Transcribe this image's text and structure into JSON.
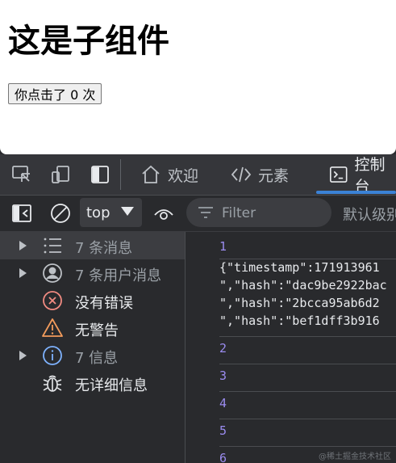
{
  "page": {
    "heading": "这是子组件",
    "button_label": "你点击了 0 次"
  },
  "devtools": {
    "tabs": [
      {
        "label": "欢迎",
        "icon": "home-icon"
      },
      {
        "label": "元素",
        "icon": "code-icon"
      },
      {
        "label": "控制台",
        "icon": "console-icon",
        "active": true
      }
    ],
    "toolbar": {
      "context": "top",
      "filter_placeholder": "Filter",
      "levels_label": "默认级别"
    },
    "sidebar": [
      {
        "label": "7 条消息",
        "icon": "list-icon",
        "expandable": true,
        "selected": true
      },
      {
        "label": "7 条用户消息",
        "icon": "user-icon",
        "expandable": true
      },
      {
        "label": "没有错误",
        "icon": "error-icon",
        "expandable": false
      },
      {
        "label": "无警告",
        "icon": "warning-icon",
        "expandable": false
      },
      {
        "label": "7 信息",
        "icon": "info-icon",
        "expandable": true
      },
      {
        "label": "无详细信息",
        "icon": "bug-icon",
        "expandable": false
      }
    ],
    "console": {
      "line_numbers": [
        "1",
        "2",
        "3",
        "4",
        "5",
        "6"
      ],
      "log_lines": [
        "{\"timestamp\":171913961",
        "\",\"hash\":\"dac9be2922bac",
        "\",\"hash\":\"2bcca95ab6d2",
        "\",\"hash\":\"bef1dff3b916"
      ]
    },
    "colors": {
      "accent": "#3b82d6",
      "line_number": "#9b8cf0",
      "error": "#f28b82",
      "warning": "#f29b5c",
      "info": "#7fb3ff"
    }
  },
  "watermark": "@稀土掘金技术社区"
}
